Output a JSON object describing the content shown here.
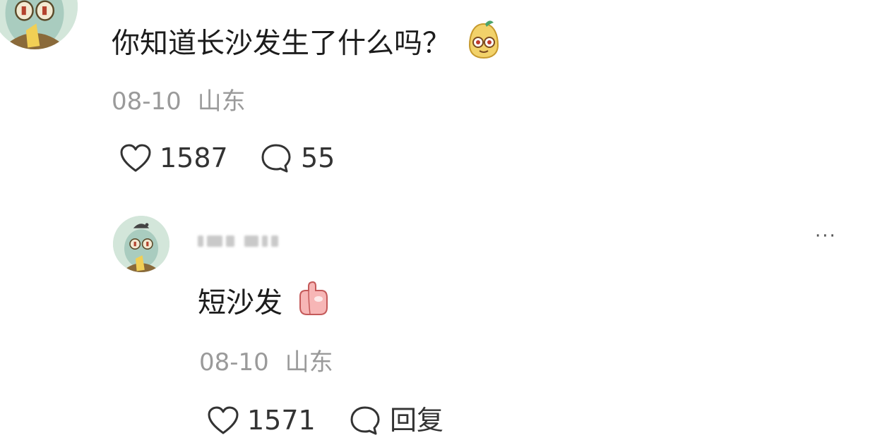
{
  "comment": {
    "text": "你知道长沙发生了什么吗？",
    "emoji": "pear-face-emoji",
    "date": "08-10",
    "location": "山东",
    "like_count": "1587",
    "reply_count": "55"
  },
  "reply": {
    "text": "短沙发",
    "emoji": "thumbs-up-emoji",
    "date": "08-10",
    "location": "山东",
    "like_count": "1571",
    "reply_label": "回复"
  },
  "icons": {
    "like": "heart-outline-icon",
    "comment": "speech-bubble-icon",
    "more": "more-dots-icon"
  },
  "colors": {
    "text": "#1c1c1c",
    "meta": "#9a9a9a",
    "avatar_bg": "#cfe3d6"
  },
  "more_label": "···"
}
